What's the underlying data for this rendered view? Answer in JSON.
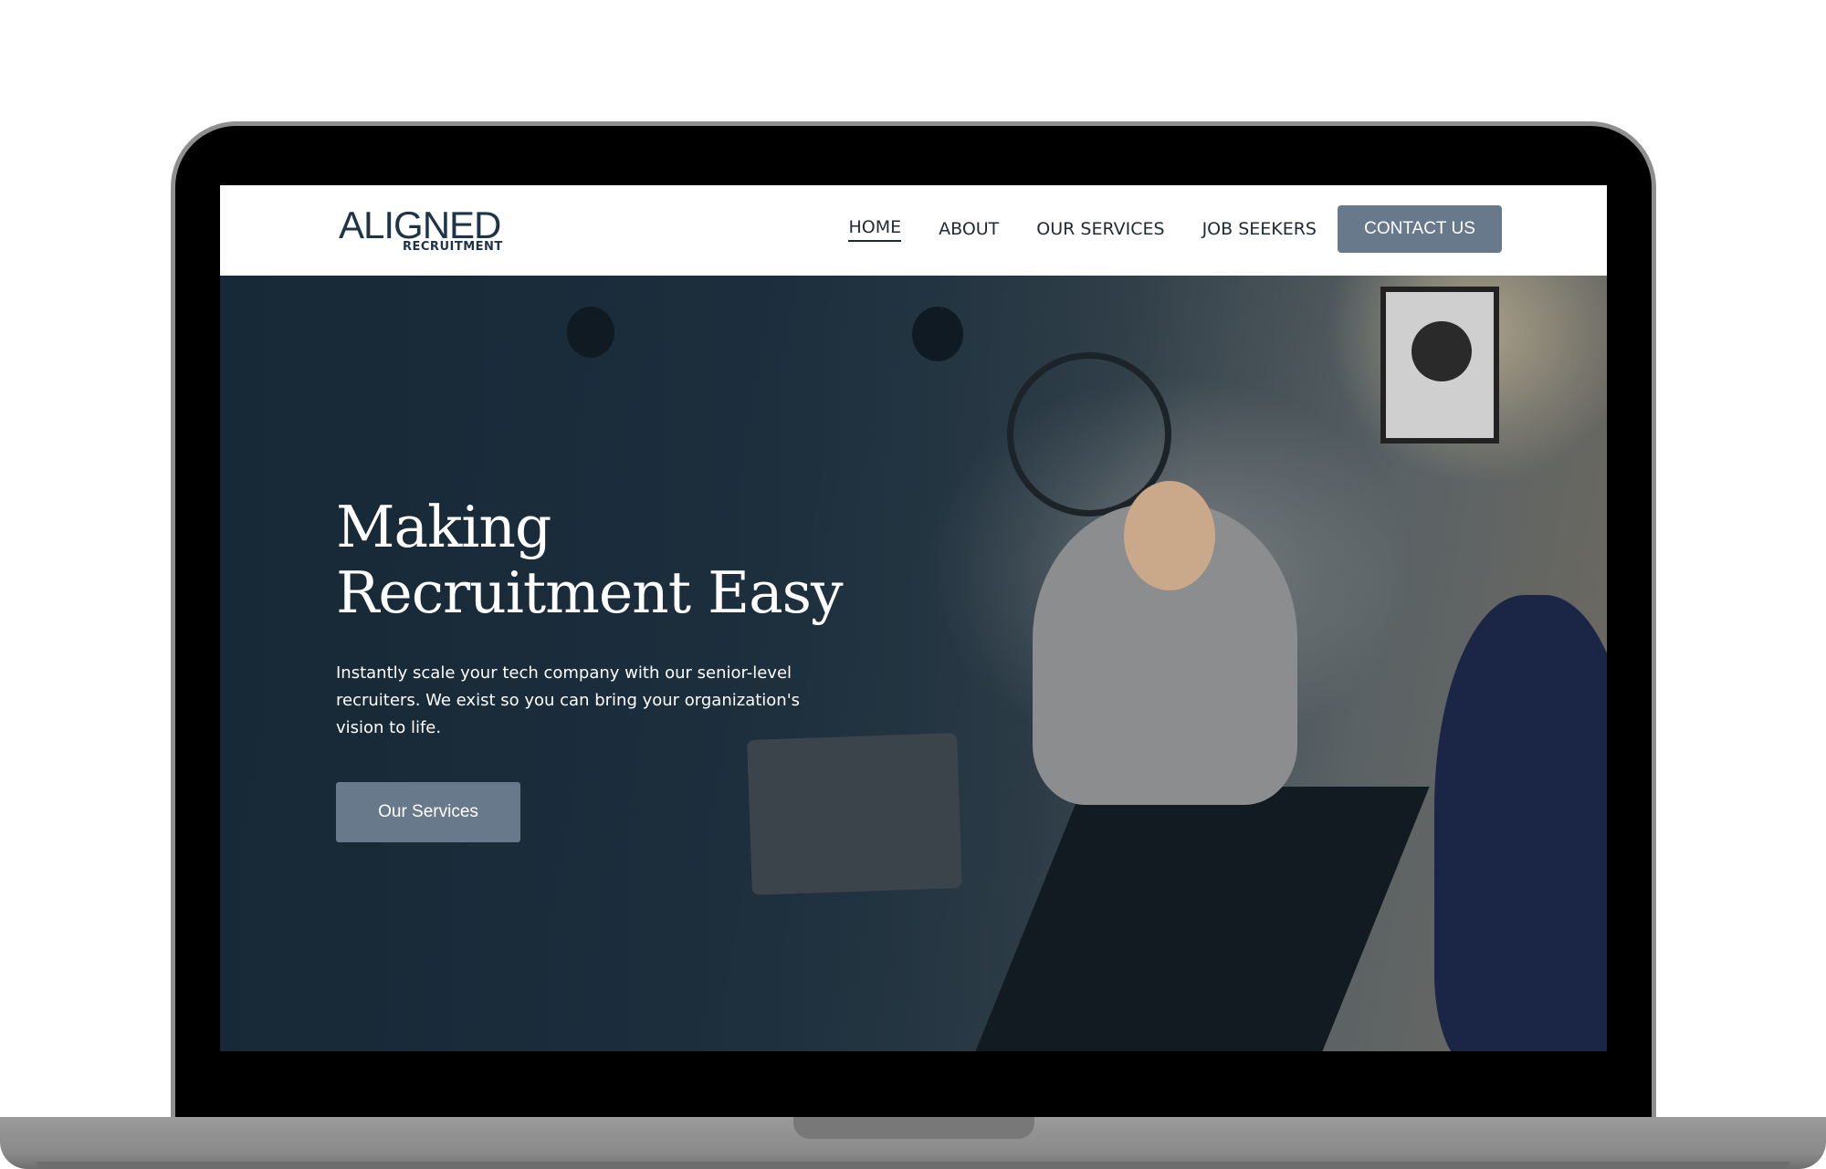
{
  "brand": {
    "logo_main": "ALIGNED",
    "logo_sub": "RECRUITMENT"
  },
  "nav": {
    "items": [
      {
        "label": "HOME",
        "active": true
      },
      {
        "label": "ABOUT",
        "active": false
      },
      {
        "label": "OUR SERVICES",
        "active": false
      },
      {
        "label": "JOB SEEKERS",
        "active": false
      }
    ],
    "cta_label": "CONTACT US"
  },
  "hero": {
    "title_line1": "Making",
    "title_line2": "Recruitment Easy",
    "text": "Instantly scale your tech company with our senior-level recruiters. We exist so you can bring your organization's vision to life.",
    "button_label": "Our Services"
  },
  "colors": {
    "accent": "#67798a",
    "brand_dark": "#1f3447",
    "hero_overlay": "#1c2c3a"
  }
}
